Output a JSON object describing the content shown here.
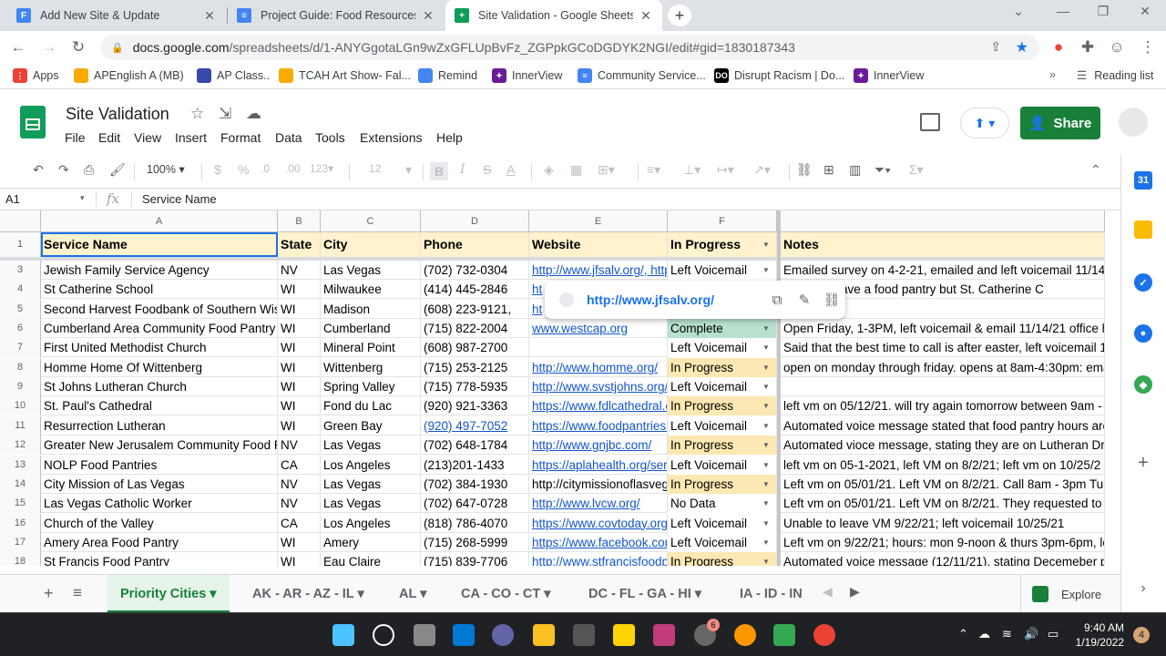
{
  "browser": {
    "tabs": [
      {
        "title": "Add New Site & Update",
        "favicon": "F",
        "color": "#4285f4",
        "active": false
      },
      {
        "title": "Project Guide: Food Resources D",
        "favicon": "≡",
        "color": "#4285f4",
        "active": false
      },
      {
        "title": "Site Validation - Google Sheets",
        "favicon": "+",
        "color": "#0f9d58",
        "active": true
      }
    ],
    "url_host": "docs.google.com",
    "url_path": "/spreadsheets/d/1-ANYGgotaLGn9wZxGFLUpBvFz_ZGPpkGCoDGDYK2NGI/edit#gid=1830187343",
    "bookmarks": [
      {
        "label": "Apps",
        "color": "#ea4335",
        "glyph": "⋮⋮"
      },
      {
        "label": "APEnglish A (MB)",
        "color": "#f9ab00",
        "glyph": "▭"
      },
      {
        "label": "AP Class..",
        "color": "#3949ab",
        "glyph": "◈"
      },
      {
        "label": "TCAH Art Show- Fal...",
        "color": "#f9ab00",
        "glyph": "🏆"
      },
      {
        "label": "Remind",
        "color": "#4285f4",
        "glyph": "◉"
      },
      {
        "label": "InnerView",
        "color": "#6a1b9a",
        "glyph": "✦"
      },
      {
        "label": "Community Service...",
        "color": "#4285f4",
        "glyph": "≡"
      },
      {
        "label": "Disrupt Racism | Do...",
        "color": "#000000",
        "glyph": "DO"
      },
      {
        "label": "InnerView",
        "color": "#6a1b9a",
        "glyph": "✦"
      }
    ],
    "reading_list": "Reading list",
    "more": "»"
  },
  "doc": {
    "title": "Site Validation",
    "menus": [
      "File",
      "Edit",
      "View",
      "Insert",
      "Format",
      "Data",
      "Tools",
      "Extensions",
      "Help"
    ],
    "share_label": "Share"
  },
  "toolbar": {
    "zoom": "100%",
    "currency": "$",
    "percent": "%",
    "dec_less": ".0",
    "dec_more": ".00",
    "number_format": "123",
    "font_size": "12"
  },
  "formula": {
    "cell_ref": "A1",
    "fx": "fx",
    "value": "Service Name"
  },
  "columns": [
    "A",
    "B",
    "C",
    "D",
    "E",
    "F",
    ""
  ],
  "header_row": {
    "num": "1",
    "cells": [
      "Service Name",
      "State",
      "City",
      "Phone",
      "Website",
      "In Progress",
      "Notes"
    ]
  },
  "rows": [
    {
      "num": "3",
      "name": "Jewish Family Service Agency",
      "state": "NV",
      "city": "Las Vegas",
      "phone": "(702) 732-0304",
      "website": "http://www.jfsalv.org/, http",
      "status": "Left Voicemail",
      "notes": "Emailed survey on 4-2-21, emailed and left voicemail 11/14/"
    },
    {
      "num": "4",
      "name": "St Catherine School",
      "state": "WI",
      "city": "Milwaukee",
      "phone": "(414) 445-2846",
      "website": "ht",
      "status": "",
      "notes": "does not have a food pantry but St. Catherine C"
    },
    {
      "num": "5",
      "name": "Second Harvest Foodbank of Southern Wis",
      "state": "WI",
      "city": "Madison",
      "phone": "(608) 223-9121,",
      "website": "ht",
      "status": "",
      "notes": "il 11/14/21"
    },
    {
      "num": "6",
      "name": "Cumberland Area Community Food Pantry",
      "state": "WI",
      "city": "Cumberland",
      "phone": "(715) 822-2004",
      "website": "www.westcap.org",
      "status": "Complete",
      "notes": "Open Friday, 1-3PM, left voicemail & email 11/14/21 office h"
    },
    {
      "num": "7",
      "name": "First United Methodist Church",
      "state": "WI",
      "city": "Mineral Point",
      "phone": "(608) 987-2700",
      "website": "",
      "status": "Left Voicemail",
      "notes": "Said that the best time to call is after easter, left voicemail 1"
    },
    {
      "num": "8",
      "name": "Homme Home Of Wittenberg",
      "state": "WI",
      "city": "Wittenberg",
      "phone": "(715) 253-2125",
      "website": "http://www.homme.org/",
      "status": "In Progress",
      "notes": "open on monday through friday. opens at 8am-4:30pm: ema"
    },
    {
      "num": "9",
      "name": "St Johns Lutheran Church",
      "state": "WI",
      "city": "Spring Valley",
      "phone": "(715) 778-5935",
      "website": "http://www.svstjohns.org/",
      "status": "Left Voicemail",
      "notes": ""
    },
    {
      "num": "10",
      "name": "St. Paul's Cathedral",
      "state": "WI",
      "city": "Fond du Lac",
      "phone": "(920) 921-3363",
      "website": "https://www.fdlcathedral.c",
      "status": "In Progress",
      "notes": "left vm on 05/12/21. will try again tomorrow between 9am - "
    },
    {
      "num": "11",
      "name": "Resurrection Lutheran",
      "state": "WI",
      "city": "Green Bay",
      "phone": "(920) 497-7052",
      "website": "https://www.foodpantries.",
      "status": "Left Voicemail",
      "notes": "Automated voice message stated that food pantry hours are"
    },
    {
      "num": "12",
      "name": "Greater New Jerusalem Community Food F",
      "state": "NV",
      "city": "Las Vegas",
      "phone": "(702) 648-1784",
      "website": "http://www.gnjbc.com/",
      "status": "In Progress",
      "notes": "Automated vioce message, stating they are on Lutheran Dri"
    },
    {
      "num": "13",
      "name": "NOLP Food Pantries",
      "state": "CA",
      "city": "Los Angeles",
      "phone": "(213)201-1433",
      "website": "https://aplahealth.org/ser",
      "status": "Left Voicemail",
      "notes": " left vm on 05-1-2021, left VM on 8/2/21; left vm on 10/25/2"
    },
    {
      "num": "14",
      "name": "City Mission of Las Vegas",
      "state": "NV",
      "city": "Las Vegas",
      "phone": "(702) 384-1930",
      "website": "http://citymissionoflasveg",
      "status": "In Progress",
      "notes": "Left vm on 05/01/21. Left VM on 8/2/21. Call 8am - 3pm Tue"
    },
    {
      "num": "15",
      "name": "Las Vegas Catholic Worker",
      "state": "NV",
      "city": "Las Vegas",
      "phone": "(702) 647-0728",
      "website": "http://www.lvcw.org/",
      "status": "No Data",
      "notes": "Left vm on 05/01/21. Left VM on 8/2/21. They requested to t"
    },
    {
      "num": "16",
      "name": "Church of the Valley",
      "state": "CA",
      "city": "Los Angeles",
      "phone": "(818) 786-4070",
      "website": "https://www.covtoday.org",
      "status": "Left Voicemail",
      "notes": "Unable to leave VM 9/22/21; left voicemail 10/25/21"
    },
    {
      "num": "17",
      "name": "Amery Area Food Pantry",
      "state": "WI",
      "city": "Amery",
      "phone": "(715) 268-5999",
      "website": "https://www.facebook.com",
      "status": "Left Voicemail",
      "notes": "Left vm on 9/22/21; hours: mon 9-noon & thurs 3pm-6pm, le"
    },
    {
      "num": "18",
      "name": "St Francis Food Pantry",
      "state": "WI",
      "city": "Eau Claire",
      "phone": "(715) 839-7706",
      "website": "http://www.stfrancisfoodp",
      "status": "In Progress",
      "notes": "Automated voice message (12/11/21), stating Decemeber p"
    }
  ],
  "status_colors": {
    "In Progress": "#fce8b2",
    "Complete": "#b7e1cd",
    "Left Voicemail": "#ffffff",
    "No Data": "#ffffff",
    "": "#ffffff"
  },
  "link_popup": {
    "url": "http://www.jfsalv.org/"
  },
  "sheet_tabs": [
    "Priority Cities",
    "AK - AR - AZ - IL",
    "AL",
    "CA - CO - CT",
    "DC - FL - GA - HI",
    "IA - ID - IN"
  ],
  "explore_label": "Explore",
  "taskbar": {
    "time": "9:40 AM",
    "date": "1/19/2022",
    "notifications": "4",
    "badge": "6"
  }
}
